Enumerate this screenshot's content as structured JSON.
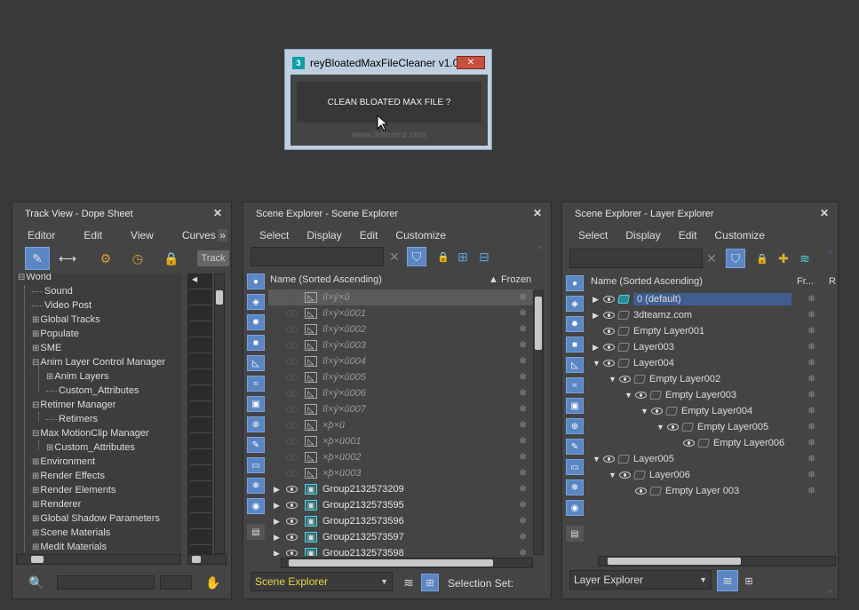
{
  "dialog": {
    "title": "reyBloatedMaxFileCleaner v1.0",
    "logo": "3",
    "close": "✕",
    "button": "CLEAN BLOATED MAX FILE ?",
    "watermark": "www.3dteamz.com"
  },
  "trackview": {
    "title": "Track View - Dope Sheet",
    "close": "✕",
    "menu": [
      "Editor",
      "Edit",
      "View",
      "Curves"
    ],
    "more": "»",
    "track_label": "Track",
    "tree": [
      {
        "label": "World",
        "prefix": "⊟",
        "indent": 0
      },
      {
        "label": "Sound",
        "prefix": "",
        "indent": 1
      },
      {
        "label": "Video Post",
        "prefix": "",
        "indent": 1
      },
      {
        "label": "Global Tracks",
        "prefix": "⊞",
        "indent": 1
      },
      {
        "label": "Populate",
        "prefix": "⊞",
        "indent": 1
      },
      {
        "label": "SME",
        "prefix": "⊞",
        "indent": 1
      },
      {
        "label": "Anim Layer Control Manager",
        "prefix": "⊟",
        "indent": 1
      },
      {
        "label": "Anim Layers",
        "prefix": "⊞",
        "indent": 2
      },
      {
        "label": "Custom_Attributes",
        "prefix": "",
        "indent": 2
      },
      {
        "label": "Retimer Manager",
        "prefix": "⊟",
        "indent": 1
      },
      {
        "label": "Retimers",
        "prefix": "",
        "indent": 2
      },
      {
        "label": "Max MotionClip Manager",
        "prefix": "⊟",
        "indent": 1
      },
      {
        "label": "Custom_Attributes",
        "prefix": "⊞",
        "indent": 2
      },
      {
        "label": "Environment",
        "prefix": "⊞",
        "indent": 1
      },
      {
        "label": "Render Effects",
        "prefix": "⊞",
        "indent": 1
      },
      {
        "label": "Render Elements",
        "prefix": "⊞",
        "indent": 1
      },
      {
        "label": "Renderer",
        "prefix": "⊞",
        "indent": 1
      },
      {
        "label": "Global Shadow Parameters",
        "prefix": "⊞",
        "indent": 1
      },
      {
        "label": "Scene Materials",
        "prefix": "⊞",
        "indent": 1
      },
      {
        "label": "Medit Materials",
        "prefix": "⊞",
        "indent": 1
      }
    ]
  },
  "scene_explorer": {
    "title": "Scene Explorer - Scene Explorer",
    "close": "✕",
    "menu": [
      "Select",
      "Display",
      "Edit",
      "Customize"
    ],
    "search_clear": "✕",
    "col_name": "Name (Sorted Ascending)",
    "col_frozen": "▲ Frozen",
    "rows": [
      {
        "label": "ïî×ý×û",
        "kind": "bone",
        "selected": true
      },
      {
        "label": "ïî×ý×û001",
        "kind": "bone"
      },
      {
        "label": "ïî×ý×û002",
        "kind": "bone"
      },
      {
        "label": "ïî×ý×û003",
        "kind": "bone"
      },
      {
        "label": "ïî×ý×û004",
        "kind": "bone"
      },
      {
        "label": "ïî×ý×û005",
        "kind": "bone"
      },
      {
        "label": "ïî×ý×û006",
        "kind": "bone"
      },
      {
        "label": "ïî×ý×û007",
        "kind": "bone"
      },
      {
        "label": "×þ×ü",
        "kind": "bone"
      },
      {
        "label": "×þ×ü001",
        "kind": "bone"
      },
      {
        "label": "×þ×ü002",
        "kind": "bone"
      },
      {
        "label": "×þ×ü003",
        "kind": "bone"
      },
      {
        "label": "Group2132573209",
        "kind": "group"
      },
      {
        "label": "Group2132573595",
        "kind": "group"
      },
      {
        "label": "Group2132573596",
        "kind": "group"
      },
      {
        "label": "Group2132573597",
        "kind": "group"
      },
      {
        "label": "Group2132573598",
        "kind": "group"
      }
    ],
    "dropdown": "Scene Explorer",
    "selection_label": "Selection Set:"
  },
  "layer_explorer": {
    "title": "Scene Explorer - Layer Explorer",
    "close": "✕",
    "menu": [
      "Select",
      "Display",
      "Edit",
      "Customize"
    ],
    "search_clear": "✕",
    "col_name": "Name (Sorted Ascending)",
    "col_frozen": "Fr...",
    "col_r": "R",
    "rows": [
      {
        "label": "0 (default)",
        "level": 0,
        "arrow": "▶",
        "active": true
      },
      {
        "label": "3dteamz.com",
        "level": 0,
        "arrow": "▶"
      },
      {
        "label": "Empty Layer001",
        "level": 0,
        "arrow": ""
      },
      {
        "label": "Layer003",
        "level": 0,
        "arrow": "▶"
      },
      {
        "label": "Layer004",
        "level": 0,
        "arrow": "◢"
      },
      {
        "label": "Empty Layer002",
        "level": 1,
        "arrow": "◢"
      },
      {
        "label": "Empty Layer003",
        "level": 2,
        "arrow": "◢"
      },
      {
        "label": "Empty Layer004",
        "level": 3,
        "arrow": "◢"
      },
      {
        "label": "Empty Layer005",
        "level": 4,
        "arrow": "◢"
      },
      {
        "label": "Empty Layer006",
        "level": 5,
        "arrow": ""
      },
      {
        "label": "Layer005",
        "level": 0,
        "arrow": "◢"
      },
      {
        "label": "Layer006",
        "level": 1,
        "arrow": "◢"
      },
      {
        "label": "Empty Layer 003",
        "level": 2,
        "arrow": ""
      }
    ],
    "dropdown": "Layer Explorer"
  },
  "colors": {
    "accent": "#5b86c4",
    "dropdown_text": "#e6d84a"
  }
}
